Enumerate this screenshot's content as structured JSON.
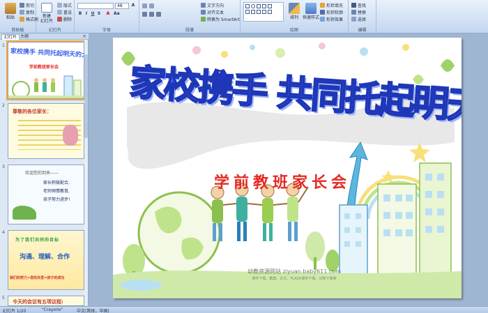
{
  "ribbon": {
    "clipboard": {
      "paste": "粘贴",
      "cut": "剪切",
      "copy": "复制",
      "format_painter": "格式刷",
      "label": "剪贴板"
    },
    "slides": {
      "new_slide": "新建\n幻灯片",
      "layout": "版式",
      "reset": "重设",
      "delete": "删除",
      "label": "幻灯片"
    },
    "font": {
      "font_name": "",
      "font_size": "48",
      "label": "字体"
    },
    "paragraph": {
      "text_direction": "文字方向",
      "align_text": "对齐文本",
      "smartart": "转换为 SmartArt",
      "label": "段落"
    },
    "drawing": {
      "arrange": "排列",
      "quick_styles": "快速样式",
      "shape_fill": "形状填充",
      "shape_outline": "形状轮廓",
      "shape_effects": "形状效果",
      "label": "绘图"
    },
    "editing": {
      "find": "查找",
      "replace": "替换",
      "select": "选择",
      "label": "编辑"
    }
  },
  "panel": {
    "tabs": [
      "幻灯片",
      "大纲"
    ],
    "close": "×",
    "thumbnails": [
      {
        "num": "1",
        "title": "家校携手 共同托起明天的太阳",
        "sub": "学前教班家长会"
      },
      {
        "num": "2",
        "title": "尊敬的各位家长："
      },
      {
        "num": "3",
        "title": "欢迎您的到来——",
        "lines": [
          "家长积极配合,",
          "老师倾情教育,",
          "孩子努力进步!"
        ]
      },
      {
        "num": "4",
        "title": "为了我们共同的目标",
        "mid": "沟通、理解、合作",
        "bottom": "我们的努力+您的关爱=孩子的成功"
      },
      {
        "num": "5",
        "title": "今天的会议有五项议程:"
      }
    ]
  },
  "slide": {
    "title": "家校携手 共同托起明天的太阳",
    "subtitle": "学前教班家长会",
    "watermark": "幼教资源网站 ziyuan.baby611.com",
    "watermark_sub": "课件下载、教案、论文、FLASH课件下载、试卷下载等"
  },
  "status": {
    "slide_info": "幻灯片 1/20",
    "theme": "\"Crayons\"",
    "language": "中文(简体，中国)"
  },
  "colors": {
    "title_blue": "#3e63e6",
    "subtitle_red": "#e52a22",
    "ribbon_blue": "#cfdff3"
  }
}
